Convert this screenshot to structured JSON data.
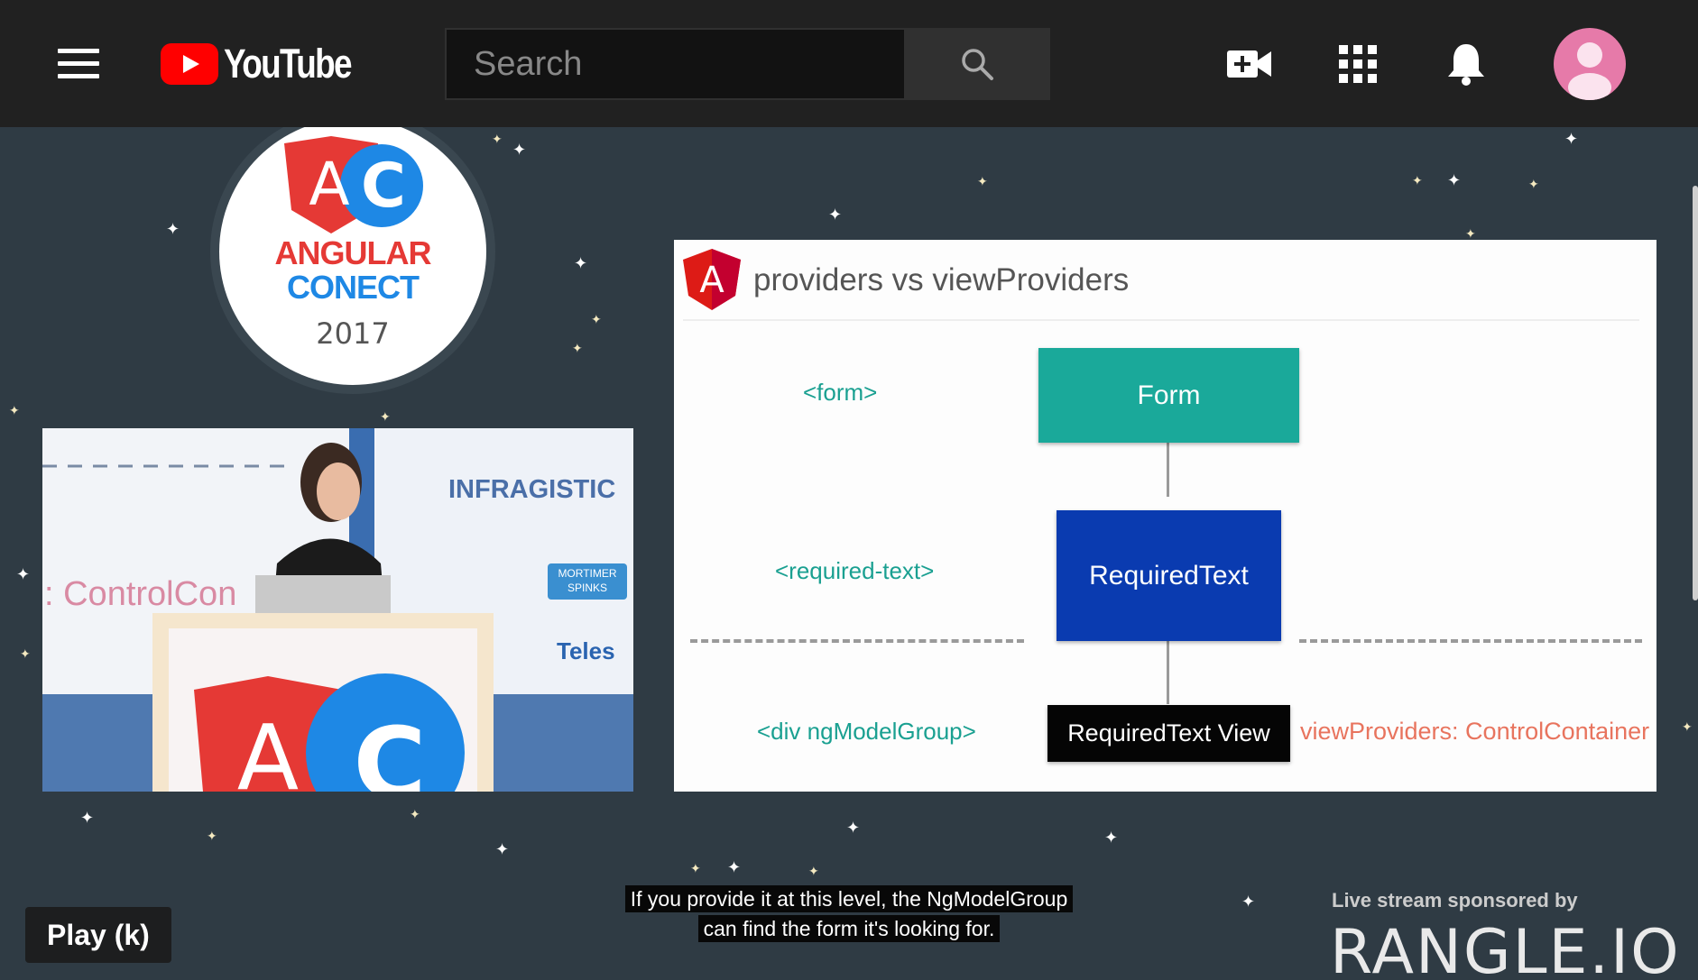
{
  "header": {
    "logo_text": "YouTube",
    "search_placeholder": "Search"
  },
  "conference": {
    "name_line1": "ANGULAR",
    "name_line2": "CONECT",
    "year": "2017",
    "logo_letters": "AC"
  },
  "stage": {
    "screen_text": ": ControlCon",
    "sponsor1": "INFRAGISTIC",
    "sponsor2_line1": "MORTIMER",
    "sponsor2_line2": "SPINKS",
    "sponsor3": "Teles"
  },
  "slide": {
    "title": "providers vs viewProviders",
    "logo_letter": "A",
    "rows": [
      {
        "tag": "<form>",
        "box": "Form",
        "color": "#1aa99a"
      },
      {
        "tag": "<required-text>",
        "box": "RequiredText",
        "color": "#0a3bb0"
      },
      {
        "tag": "<div ngModelGroup>",
        "box": "RequiredText View",
        "color": "#050505"
      }
    ],
    "view_providers_label": "viewProviders: ControlContainer"
  },
  "player": {
    "play_button": "Play (k)",
    "caption_line1": "If you provide it at this level, the NgModelGroup",
    "caption_line2": "can find the form it's looking for."
  },
  "sponsor": {
    "label": "Live stream sponsored by",
    "name": "RANGLE.IO"
  }
}
